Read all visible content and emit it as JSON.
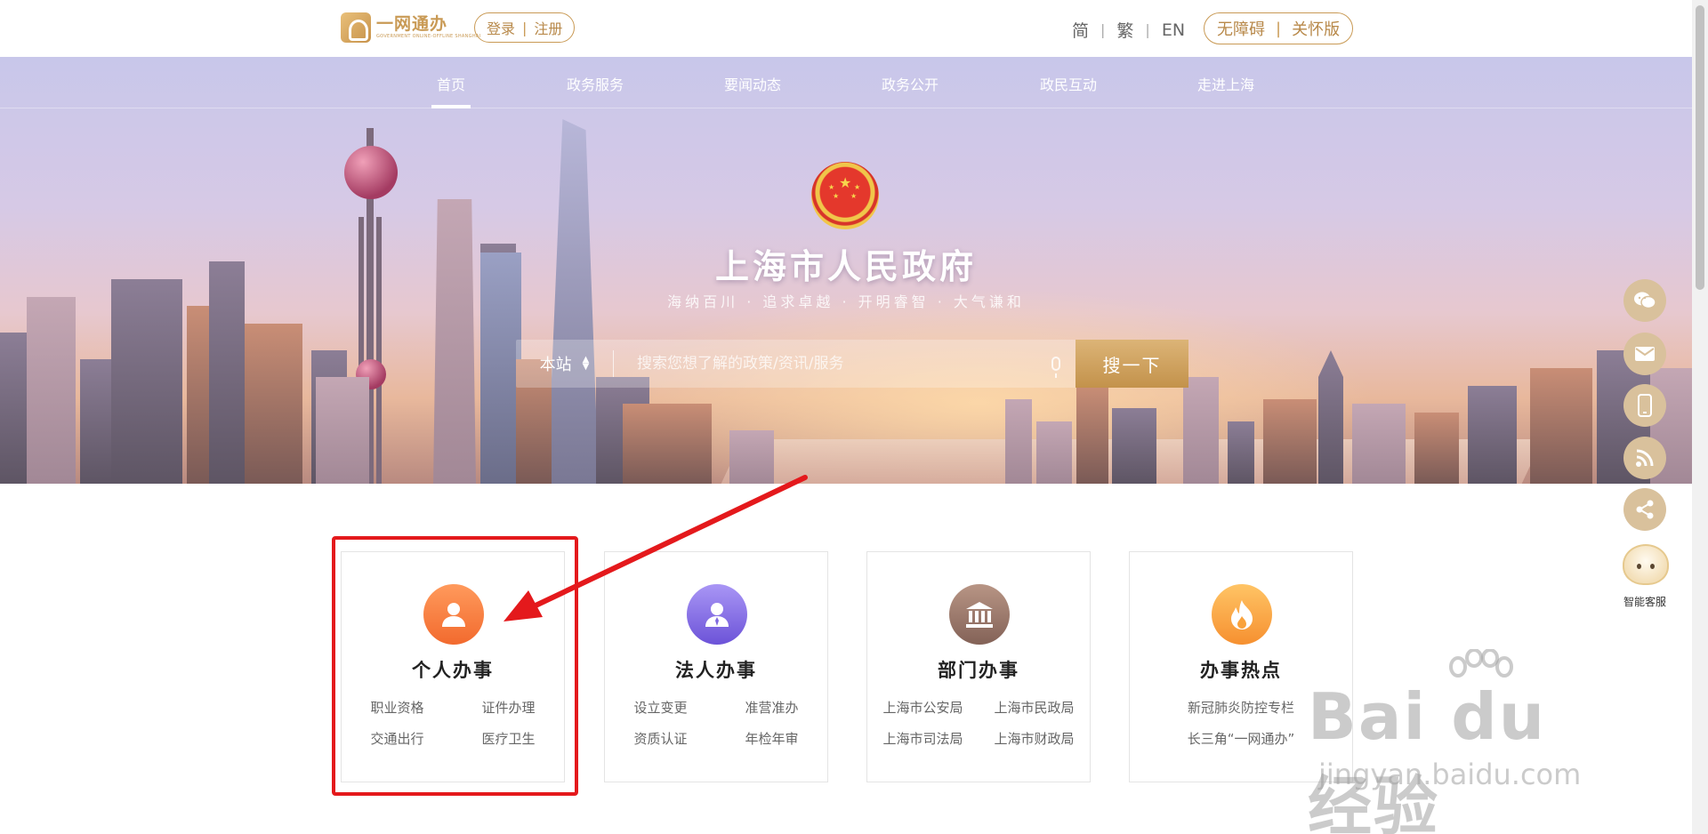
{
  "header": {
    "logo_text": "一网通办",
    "logo_subtext": "GOVERNMENT ONLINE-OFFLINE SHANGHAI",
    "login_label": "登录",
    "register_label": "注册",
    "lang_simplified": "简",
    "lang_traditional": "繁",
    "lang_english": "EN",
    "accessible_label": "无障碍",
    "elderly_label": "关怀版"
  },
  "nav": {
    "items": [
      "首页",
      "政务服务",
      "要闻动态",
      "政务公开",
      "政民互动",
      "走进上海"
    ],
    "active": "首页"
  },
  "hero": {
    "title": "上海市人民政府",
    "subtitle": "海纳百川 · 追求卓越 · 开明睿智 · 大气谦和"
  },
  "search": {
    "scope_label": "本站",
    "placeholder": "搜索您想了解的政策/资讯/服务",
    "button_label": "搜一下"
  },
  "cards": [
    {
      "title": "个人办事",
      "links": [
        "职业资格",
        "证件办理",
        "交通出行",
        "医疗卫生"
      ]
    },
    {
      "title": "法人办事",
      "links": [
        "设立变更",
        "准营准办",
        "资质认证",
        "年检年审"
      ]
    },
    {
      "title": "部门办事",
      "links": [
        "上海市公安局",
        "上海市民政局",
        "上海市司法局",
        "上海市财政局"
      ]
    },
    {
      "title": "办事热点",
      "links": [
        "新冠肺炎防控专栏",
        "长三角“一网通办”"
      ]
    }
  ],
  "side_tools": {
    "assistant_label": "智能客服",
    "icons": [
      "wechat-icon",
      "mail-icon",
      "mobile-icon",
      "rss-icon",
      "share-icon"
    ]
  },
  "watermark": {
    "brand": "Bai du 经验",
    "url": "jingyan.baidu.com"
  },
  "colors": {
    "accent_gold": "#c99a55",
    "highlight_red": "#e4191c",
    "card_person": "#f5743b",
    "card_legal": "#7f69e0",
    "card_dept": "#9a7768",
    "card_hot": "#f9a23c"
  }
}
